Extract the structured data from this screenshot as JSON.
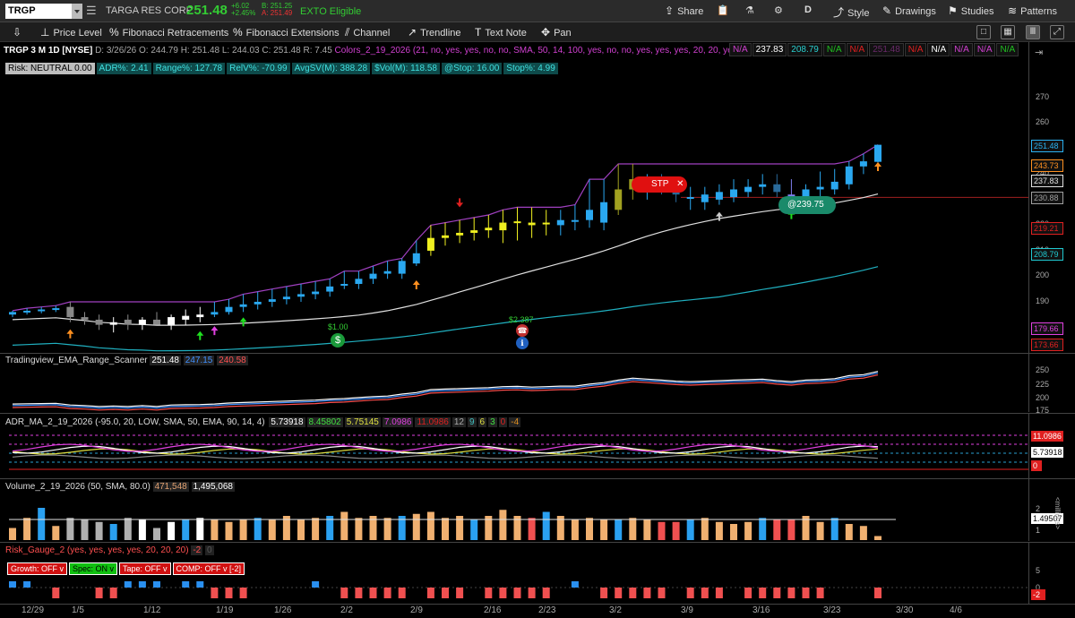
{
  "topbar": {
    "symbol": "TRGP",
    "company": "TARGA RES CORP",
    "last_price": "251.48",
    "change_abs": "+6.02",
    "change_pct": "+2.45%",
    "bid": "B: 251.25",
    "ask": "A: 251.49",
    "exto": "EXTO Eligible",
    "share": "Share",
    "period": "D",
    "style": "Style",
    "drawings": "Drawings",
    "studies": "Studies",
    "patterns": "Patterns"
  },
  "drawing_tools": [
    {
      "icon": "pin-icon",
      "label": ""
    },
    {
      "icon": "price-level-icon",
      "label": "Price Level"
    },
    {
      "icon": "fib-retracement-icon",
      "label": "Fibonacci Retracements"
    },
    {
      "icon": "fib-extension-icon",
      "label": "Fibonacci Extensions"
    },
    {
      "icon": "channel-icon",
      "label": "Channel"
    },
    {
      "icon": "trendline-icon",
      "label": "Trendline"
    },
    {
      "icon": "text-note-icon",
      "label": "Text Note"
    },
    {
      "icon": "pan-icon",
      "label": "Pan"
    }
  ],
  "price_header": {
    "title": "TRGP 3 M 1D [NYSE]",
    "date": "D: 3/26/26",
    "open": "O: 244.79",
    "high": "H: 251.48",
    "low": "L: 244.03",
    "close": "C: 251.48",
    "range": "R: 7.45",
    "study": "Colors_2_19_2026 (21, no, yes, yes, no, no, SMA, 50, 14, 100, yes, no, no, yes, yes, yes, 20, 20, yes)",
    "tags": [
      "N/A",
      "237.83",
      "208.79",
      "N/A",
      "N/A",
      "251.48",
      "N/A",
      "N/A",
      "N/A",
      "N/A",
      "N/A"
    ],
    "tag_colors": [
      "#d040d0",
      "#ffffff",
      "#2ad0d0",
      "#20c020",
      "#e02020",
      "#6a2a6a",
      "#e02020",
      "#ffffff",
      "#d040d0",
      "#d040d0",
      "#20c020"
    ]
  },
  "risk_row": [
    {
      "text": "Risk: NEUTRAL  0.00",
      "bg": "#bdbdbd",
      "fg": "#000000"
    },
    {
      "text": "ADR%: 2.41",
      "bg": "#0e4a4a",
      "fg": "#40e0e0"
    },
    {
      "text": "Range%: 127.78",
      "bg": "#0e4a4a",
      "fg": "#40e0e0"
    },
    {
      "text": "RelV%: -70.99",
      "bg": "#0e4a4a",
      "fg": "#40e0e0"
    },
    {
      "text": "AvgSV(M): 388.28",
      "bg": "#0e4a4a",
      "fg": "#40e0e0"
    },
    {
      "text": "$Vol(M): 118.58",
      "bg": "#0e4a4a",
      "fg": "#40e0e0"
    },
    {
      "text": "@Stop: 16.00",
      "bg": "#0e4a4a",
      "fg": "#40e0e0"
    },
    {
      "text": "Stop%: 4.99",
      "bg": "#0e4a4a",
      "fg": "#40e0e0"
    }
  ],
  "price_axis": [
    "270",
    "260",
    "250",
    "240",
    "230",
    "220",
    "210",
    "200",
    "190",
    "180"
  ],
  "price_tags": [
    {
      "value": "251.48",
      "color": "#2ab0f0"
    },
    {
      "value": "243.73",
      "color": "#ff9020"
    },
    {
      "value": "237.83",
      "color": "#e0e0e0"
    },
    {
      "value": "230.88",
      "color": "#a0a0a0"
    },
    {
      "value": "219.21",
      "color": "#e02020"
    },
    {
      "value": "208.79",
      "color": "#20c8d0"
    },
    {
      "value": "179.66",
      "color": "#e040e0"
    },
    {
      "value": "173.66",
      "color": "#e02020"
    }
  ],
  "annotations": {
    "stp": "STP",
    "stp_close": "✕",
    "stop_price": "@239.75",
    "dividend1": "$1.00",
    "dividend2": "$2.387"
  },
  "ema_panel": {
    "title": "Tradingview_EMA_Range_Scanner",
    "v1": "251.48",
    "v2": "247.15",
    "v3": "240.58",
    "axis": [
      "250",
      "225",
      "200",
      "175"
    ]
  },
  "adr_panel": {
    "title": "ADR_MA_2_19_2026 (-95.0, 20, LOW, SMA, 50, EMA, 90, 14, 4)",
    "values": [
      {
        "text": "5.73918",
        "color": "#ffffff"
      },
      {
        "text": "8.45802",
        "color": "#40e040"
      },
      {
        "text": "5.75145",
        "color": "#e0e040"
      },
      {
        "text": "7.0986",
        "color": "#e040e0"
      },
      {
        "text": "11.0986",
        "color": "#e02020"
      },
      {
        "text": "12",
        "color": "#aaaaaa"
      },
      {
        "text": "9",
        "color": "#40c0c0"
      },
      {
        "text": "6",
        "color": "#e0e040"
      },
      {
        "text": "3",
        "color": "#40e040"
      },
      {
        "text": "0",
        "color": "#e02020"
      },
      {
        "text": "-4",
        "color": "#e09020"
      }
    ],
    "tag_high": "11.0986",
    "tag_val": "5.73918",
    "tag_zero": "0"
  },
  "volume_panel": {
    "title": "Volume_2_19_2026 (50, SMA, 80.0)",
    "v1": "471,548",
    "v2": "1,495,068",
    "axis": [
      "2",
      "1"
    ],
    "tag": "1.49507",
    "unit": "<millions>"
  },
  "risk_panel": {
    "title": "Risk_Gauge_2 (yes, yes, yes, yes, 20, 20, 20)",
    "v1": "-2",
    "v2": "0",
    "boxes": [
      {
        "text": "Growth: OFF v",
        "state": "off"
      },
      {
        "text": "Spec: ON v",
        "state": "on"
      },
      {
        "text": "Tape: OFF v",
        "state": "off"
      },
      {
        "text": "COMP: OFF v [-2]",
        "state": "off"
      }
    ],
    "axis": [
      "5",
      "0"
    ],
    "tag": "-2"
  },
  "x_axis": [
    "12/29",
    "1/5",
    "1/12",
    "1/19",
    "1/26",
    "2/2",
    "2/9",
    "2/16",
    "2/23",
    "3/2",
    "3/9",
    "3/16",
    "3/23",
    "3/30",
    "4/6"
  ],
  "chart_data": {
    "type": "candlestick",
    "title": "TRGP 3 M 1D [NYSE]",
    "dates": [
      "12/29",
      "12/30",
      "12/31",
      "1/2",
      "1/5",
      "1/6",
      "1/7",
      "1/8",
      "1/9",
      "1/12",
      "1/13",
      "1/14",
      "1/15",
      "1/16",
      "1/20",
      "1/21",
      "1/22",
      "1/23",
      "1/26",
      "1/27",
      "1/28",
      "1/29",
      "1/30",
      "2/2",
      "2/3",
      "2/4",
      "2/5",
      "2/6",
      "2/9",
      "2/10",
      "2/11",
      "2/12",
      "2/13",
      "2/17",
      "2/18",
      "2/19",
      "2/20",
      "2/23",
      "2/24",
      "2/25",
      "2/26",
      "2/27",
      "3/2",
      "3/3",
      "3/4",
      "3/5",
      "3/6",
      "3/9",
      "3/10",
      "3/11",
      "3/12",
      "3/13",
      "3/16",
      "3/17",
      "3/18",
      "3/19",
      "3/20",
      "3/23",
      "3/24",
      "3/25",
      "3/26"
    ],
    "open": [
      185,
      186,
      186.5,
      187,
      188,
      184,
      183,
      181,
      183,
      181,
      183,
      181,
      183,
      184,
      185,
      186,
      188,
      189,
      190,
      191,
      192,
      193,
      194,
      197,
      197,
      199,
      201,
      201,
      205,
      210,
      215,
      216,
      217,
      218,
      218,
      221,
      221,
      221,
      220,
      222,
      222,
      221,
      226,
      234,
      234,
      236,
      235,
      231,
      229,
      230,
      231,
      233,
      235,
      236,
      232,
      230,
      234,
      234,
      236,
      243,
      244.8
    ],
    "high": [
      186.5,
      187.5,
      188,
      188.5,
      190,
      186,
      185,
      184,
      185,
      184,
      186,
      185,
      187,
      188,
      190,
      191,
      193,
      194,
      195,
      196,
      197,
      198,
      199,
      202,
      202,
      204,
      206,
      207,
      214,
      220,
      221,
      222,
      223,
      224,
      226,
      227,
      227,
      226,
      226,
      228,
      238,
      238,
      244,
      244,
      240,
      240,
      238,
      235,
      235,
      236,
      238,
      238,
      240,
      240,
      238,
      236,
      241,
      242,
      245,
      248,
      251.5
    ],
    "low": [
      184,
      185,
      185.5,
      186,
      182,
      181,
      179,
      178,
      179,
      179,
      181,
      179,
      181,
      182,
      184,
      185,
      186,
      187,
      188,
      189,
      190,
      191,
      192,
      195,
      195,
      197,
      199,
      199,
      204,
      208,
      212,
      213,
      214,
      215,
      213,
      214,
      215,
      216,
      216,
      218,
      219,
      218,
      224,
      230,
      230,
      232,
      229,
      226,
      226,
      228,
      229,
      231,
      232,
      231,
      228,
      228,
      231,
      232,
      234,
      240,
      244
    ],
    "close": [
      186,
      186.5,
      187,
      187.5,
      184,
      183,
      181,
      182,
      181,
      183,
      181,
      184,
      184.5,
      185,
      186,
      188,
      189,
      190,
      191,
      192,
      193,
      194,
      196,
      197,
      199,
      201,
      202,
      206,
      209,
      215,
      216,
      217,
      218,
      219,
      221,
      221.5,
      220,
      221,
      222,
      222,
      226,
      229,
      234,
      238,
      236,
      234,
      232,
      231,
      232,
      233,
      234,
      235,
      236,
      233,
      231,
      234,
      235,
      237,
      243,
      245,
      251.48
    ],
    "ylim": [
      170,
      278
    ]
  }
}
